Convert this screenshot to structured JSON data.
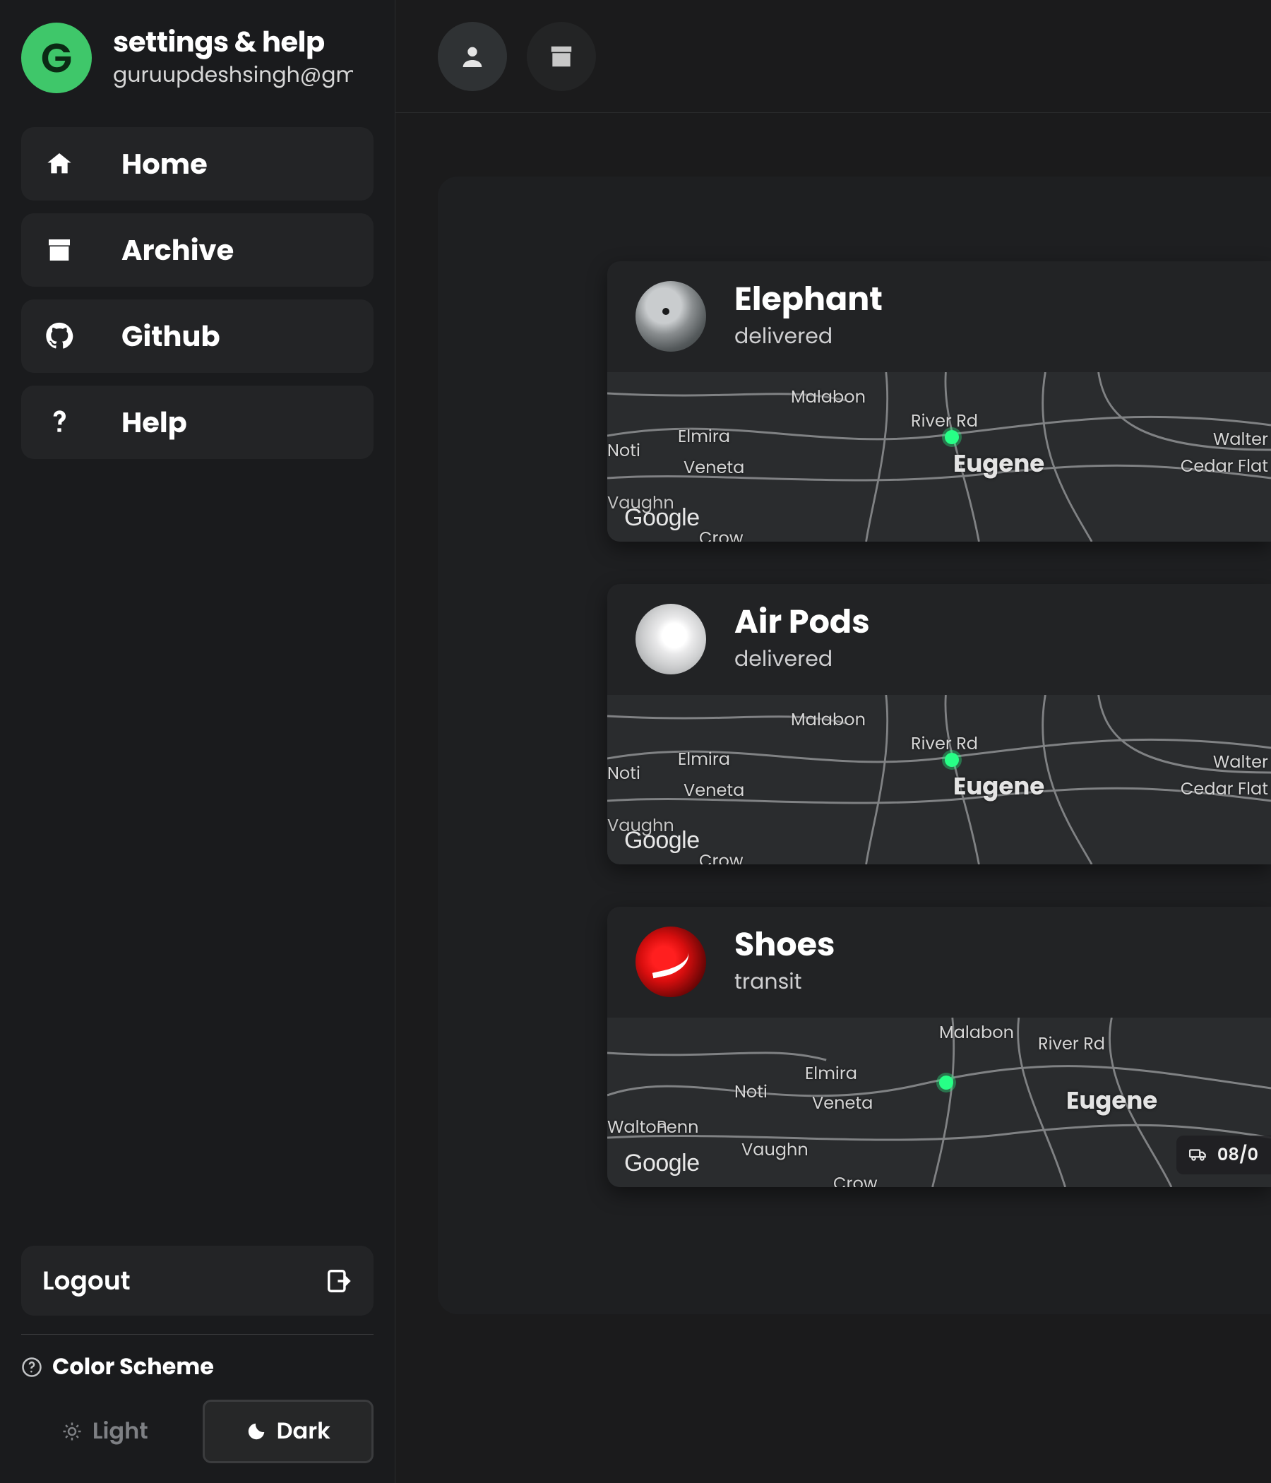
{
  "profile": {
    "avatar_initial": "G",
    "title": "settings & help",
    "email": "guruupdeshsingh@gm"
  },
  "nav": {
    "items": [
      {
        "label": "Home"
      },
      {
        "label": "Archive"
      },
      {
        "label": "Github"
      },
      {
        "label": "Help"
      }
    ]
  },
  "logout_label": "Logout",
  "color_scheme": {
    "label": "Color Scheme",
    "light": "Light",
    "dark": "Dark",
    "active": "dark"
  },
  "cards": [
    {
      "title": "Elephant",
      "status": "delivered",
      "city": "Eugene",
      "attrib": "Google",
      "labels": [
        "Malabon",
        "River Rd",
        "Elmira",
        "Noti",
        "Veneta",
        "Vaughn",
        "Crow",
        "Walter",
        "Cedar Flat"
      ]
    },
    {
      "title": "Air Pods",
      "status": "delivered",
      "city": "Eugene",
      "attrib": "Google",
      "labels": [
        "Malabon",
        "River Rd",
        "Elmira",
        "Noti",
        "Veneta",
        "Vaughn",
        "Crow",
        "Walter",
        "Cedar Flat"
      ]
    },
    {
      "title": "Shoes",
      "status": "transit",
      "city": "Eugene",
      "attrib": "Google",
      "labels": [
        "Malabon",
        "River Rd",
        "Elmira",
        "Noti",
        "Veneta",
        "Penn",
        "Vaughn",
        "Crow",
        "Walton"
      ],
      "date": "08/0"
    }
  ],
  "colors": {
    "accent_green": "#27ff86",
    "avatar_green": "#3fc76a"
  }
}
